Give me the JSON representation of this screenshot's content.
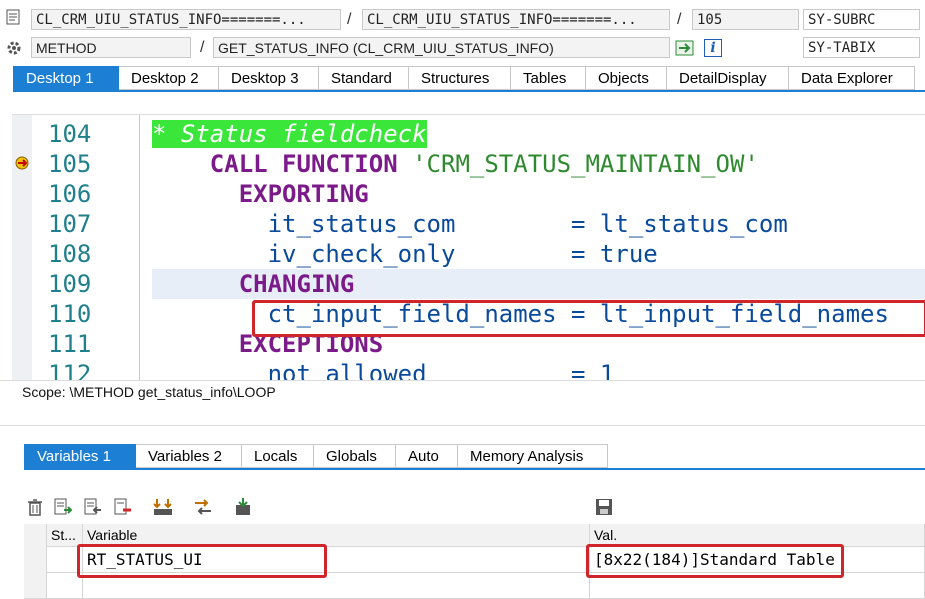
{
  "header": {
    "program": "CL_CRM_UIU_STATUS_INFO=======...",
    "include": "CL_CRM_UIU_STATUS_INFO=======...",
    "line": "105",
    "sy_subrc_label": "SY-SUBRC",
    "event_type": "METHOD",
    "event": "GET_STATUS_INFO (CL_CRM_UIU_STATUS_INFO)",
    "sy_tabix_label": "SY-TABIX",
    "info_icon_label": "i"
  },
  "desktop_tabs": [
    "Desktop 1",
    "Desktop 2",
    "Desktop 3",
    "Standard",
    "Structures",
    "Tables",
    "Objects",
    "DetailDisplay",
    "Data Explorer"
  ],
  "code": {
    "lines": [
      {
        "num": "104",
        "parts": [
          {
            "t": "* Status fieldcheck",
            "c": "comment"
          }
        ]
      },
      {
        "num": "105",
        "parts": [
          {
            "t": "    ",
            "c": ""
          },
          {
            "t": "CALL FUNCTION",
            "c": "kw"
          },
          {
            "t": " ",
            "c": ""
          },
          {
            "t": "'CRM_STATUS_MAINTAIN_OW'",
            "c": "str"
          }
        ]
      },
      {
        "num": "106",
        "parts": [
          {
            "t": "      ",
            "c": ""
          },
          {
            "t": "EXPORTING",
            "c": "kw"
          }
        ]
      },
      {
        "num": "107",
        "parts": [
          {
            "t": "        it_status_com        = lt_status_com",
            "c": "id"
          }
        ]
      },
      {
        "num": "108",
        "parts": [
          {
            "t": "        iv_check_only        = true",
            "c": "id"
          }
        ]
      },
      {
        "num": "109",
        "parts": [
          {
            "t": "      ",
            "c": ""
          },
          {
            "t": "CHANGING",
            "c": "kw"
          }
        ]
      },
      {
        "num": "110",
        "parts": [
          {
            "t": "        ct_input_field_names = lt_input_field_names",
            "c": "id"
          }
        ]
      },
      {
        "num": "111",
        "parts": [
          {
            "t": "      ",
            "c": ""
          },
          {
            "t": "EXCEPTIONS",
            "c": "kw"
          }
        ]
      },
      {
        "num": "112",
        "parts": [
          {
            "t": "        not_allowed          = 1",
            "c": "id"
          }
        ]
      }
    ]
  },
  "scope": "Scope: \\METHOD get_status_info\\LOOP",
  "variable_tabs": [
    "Variables 1",
    "Variables 2",
    "Locals",
    "Globals",
    "Auto",
    "Memory Analysis"
  ],
  "variables_table": {
    "headers": {
      "status": "St...",
      "variable": "Variable",
      "value": "Val."
    },
    "rows": [
      {
        "variable": "RT_STATUS_UI",
        "value": "[8x22(184)]Standard Table"
      }
    ]
  },
  "colors": {
    "accent": "#1d7fd4",
    "highlight_box": "#d0262b",
    "comment_bg": "#3ae63a",
    "keyword": "#7b1b8a",
    "string": "#2f8a2f"
  }
}
